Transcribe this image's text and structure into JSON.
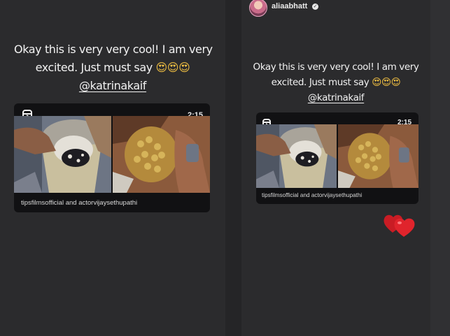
{
  "left_post": {
    "caption_line1": "Okay this is very very cool! I am very",
    "caption_line2_text": "excited. Just must say ",
    "caption_line2_emoji": "😍😍😍",
    "mention": "@katrinakaif",
    "reel": {
      "duration": "2:15",
      "credit": "tipsfilmsofficial and actorvijaysethupathi"
    }
  },
  "right_post": {
    "username": "aliaabhatt",
    "caption_line1": "Okay this is very very cool! I am very",
    "caption_line2_text": "excited. Just must say ",
    "caption_line2_emoji": "😍😍😍",
    "mention": "@katrinakaif",
    "reel": {
      "duration": "2:15",
      "credit": "tipsfilmsofficial and actorvijaysethupathi"
    },
    "sticker": "hearts-icon"
  },
  "colors": {
    "background": "#2b2b2d",
    "text": "#f2f2f2",
    "heart": "#e0242c"
  }
}
